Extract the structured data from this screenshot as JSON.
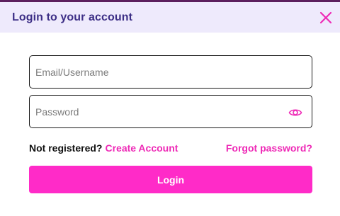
{
  "dialog": {
    "title": "Login to your account",
    "close_icon": "close-icon"
  },
  "form": {
    "username": {
      "placeholder": "Email/Username",
      "value": ""
    },
    "password": {
      "placeholder": "Password",
      "value": "",
      "toggle_icon": "eye-icon"
    },
    "not_registered": "Not registered?",
    "create_account": "Create Account",
    "forgot_password": "Forgot password?",
    "login_label": "Login"
  },
  "colors": {
    "accent": "#ff2bc8",
    "link": "#ee2ab6",
    "title": "#3d2f86",
    "header_bg": "#eeeafc"
  }
}
